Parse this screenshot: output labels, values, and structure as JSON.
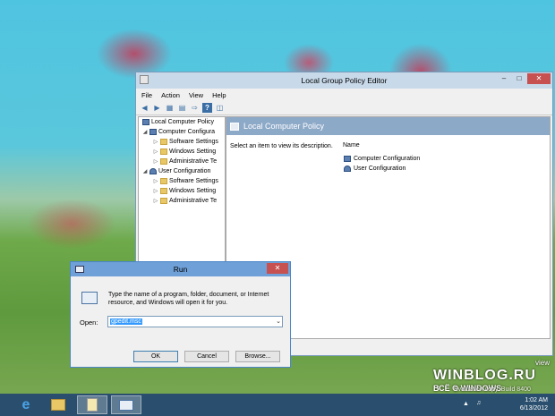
{
  "gpedit": {
    "title": "Local Group Policy Editor",
    "menu": [
      "File",
      "Action",
      "View",
      "Help"
    ],
    "tree": [
      {
        "label": "Local Computer Policy",
        "icon": "computer-icon"
      },
      {
        "label": "Computer Configura",
        "icon": "computer-icon"
      },
      {
        "label": "Software Settings",
        "icon": "folder-icon"
      },
      {
        "label": "Windows Setting",
        "icon": "folder-icon"
      },
      {
        "label": "Administrative Te",
        "icon": "folder-icon"
      },
      {
        "label": "User Configuration",
        "icon": "user-icon"
      },
      {
        "label": "Software Settings",
        "icon": "folder-icon"
      },
      {
        "label": "Windows Setting",
        "icon": "folder-icon"
      },
      {
        "label": "Administrative Te",
        "icon": "folder-icon"
      }
    ],
    "pane_title": "Local Computer Policy",
    "description": "Select an item to view its description.",
    "column_name": "Name",
    "items": [
      "Computer Configuration",
      "User Configuration"
    ]
  },
  "run": {
    "title": "Run",
    "prompt": "Type the name of a program, folder, document, or Internet resource, and Windows will open it for you.",
    "open_label": "Open:",
    "open_value": "gpedit.msc",
    "ok": "OK",
    "cancel": "Cancel",
    "browse": "Browse..."
  },
  "taskbar": {
    "time": "1:02 AM",
    "date": "6/13/2012"
  },
  "watermark": {
    "site": "WINBLOG.RU",
    "sub": "ВСЁ О WINDOWS",
    "build_partial": "Evaluation copy. Build 8400",
    "view_partial": "view"
  },
  "colors": {
    "accent": "#2a4f6e",
    "close": "#c75050",
    "run_title": "#6fa0d7"
  }
}
